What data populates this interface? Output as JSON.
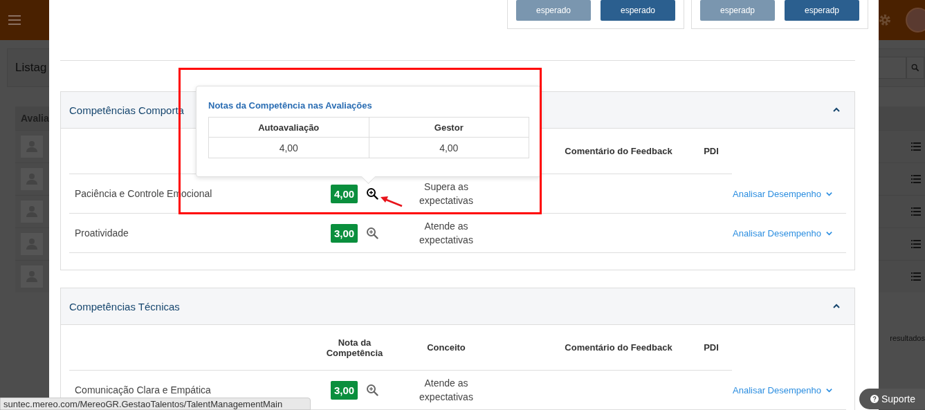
{
  "background": {
    "title": "Listag",
    "column_header": "Avalia",
    "results_text": "resultados"
  },
  "modal": {
    "rating_groups": [
      {
        "buttons": [
          {
            "label": "esperado",
            "selected": false
          },
          {
            "label": "esperado",
            "selected": true
          }
        ]
      },
      {
        "buttons": [
          {
            "label": "esperadp",
            "selected": false
          },
          {
            "label": "esperadp",
            "selected": true
          }
        ]
      }
    ],
    "sections": [
      {
        "title": "Competências Comporta",
        "expanded": true,
        "columns": {
          "feedback": "Comentário do Feedback",
          "pdi": "PDI"
        },
        "rows": [
          {
            "name": "Paciência e Controle Emocional",
            "score": "4,00",
            "color": "#0a8f3d",
            "zoom_active": true,
            "concept": "Supera as expectativas",
            "link": "Analisar Desempenho"
          },
          {
            "name": "Proatividade",
            "score": "3,00",
            "color": "#0a8f3d",
            "zoom_active": false,
            "concept": "Atende as expectativas",
            "link": "Analisar Desempenho"
          }
        ]
      },
      {
        "title": "Competências Técnicas",
        "expanded": true,
        "columns": {
          "score": "Nota da Competência",
          "concept": "Conceito",
          "feedback": "Comentário do Feedback",
          "pdi": "PDI"
        },
        "rows": [
          {
            "name": "Comunicação Clara e Empática",
            "score": "3,00",
            "color": "#0a8f3d",
            "zoom_active": false,
            "concept": "Atende as expectativas",
            "link": "Analisar Desempenho"
          }
        ]
      }
    ],
    "popover": {
      "title": "Notas da Competência nas Avaliações",
      "columns": [
        "Autoavaliação",
        "Gestor"
      ],
      "values": [
        "4,00",
        "4,00"
      ]
    }
  },
  "status_url": "suntec.mereo.com/MereoGR.GestaoTalentos/TalentManagementMain",
  "support_button": {
    "label": "Suporte"
  }
}
